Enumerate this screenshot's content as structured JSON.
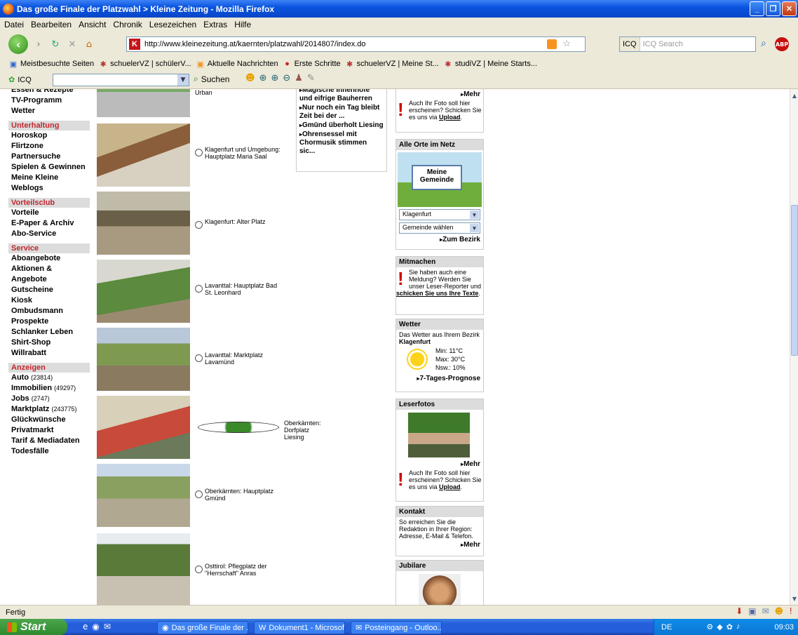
{
  "window": {
    "title": "Das große Finale der Platzwahl > Kleine Zeitung - Mozilla Firefox"
  },
  "menu": [
    "Datei",
    "Bearbeiten",
    "Ansicht",
    "Chronik",
    "Lesezeichen",
    "Extras",
    "Hilfe"
  ],
  "url": "http://www.kleinezeitung.at/kaernten/platzwahl/2014807/index.do",
  "search": {
    "placeholder": "ICQ Search",
    "label": "ICQ"
  },
  "bookmarks": [
    "Meistbesuchte Seiten",
    "schuelerVZ | schülerV...",
    "Aktuelle Nachrichten",
    "Erste Schritte",
    "schuelerVZ | Meine St...",
    "studiVZ | Meine Starts..."
  ],
  "icqbar": {
    "label": "ICQ",
    "search_button": "Suchen"
  },
  "leftnav": {
    "top_items": [
      "Essen & Rezepte",
      "TV-Programm",
      "Wetter"
    ],
    "sections": [
      {
        "head": "Unterhaltung",
        "items": [
          "Horoskop",
          "Flirtzone",
          "Partnersuche",
          "Spielen & Gewinnen",
          "Meine Kleine Weblogs"
        ]
      },
      {
        "head": "Vorteilsclub",
        "items": [
          "Vorteile",
          "E-Paper & Archiv",
          "Abo-Service"
        ]
      },
      {
        "head": "Service",
        "items": [
          "Aboangebote",
          "Aktionen & Angebote",
          "Gutscheine",
          "Kiosk",
          "Ombudsmann",
          "Prospekte",
          "Schlanker Leben",
          "Shirt-Shop",
          "Willrabatt"
        ]
      },
      {
        "head": "Anzeigen",
        "items": [
          {
            "label": "Auto",
            "count": "(23814)"
          },
          {
            "label": "Immobilien",
            "count": "(49297)"
          },
          {
            "label": "Jobs",
            "count": "(2747)"
          },
          {
            "label": "Marktplatz",
            "count": "(243775)"
          },
          {
            "label": "Glückwünsche",
            "count": ""
          },
          {
            "label": "Privatmarkt",
            "count": ""
          },
          {
            "label": "Tarif & Mediadaten",
            "count": ""
          },
          {
            "label": "Todesfälle",
            "count": ""
          }
        ]
      }
    ]
  },
  "places": [
    {
      "label": "Urban",
      "selected": false
    },
    {
      "label": "Klagenfurt und Umgebung: Hauptplatz Maria Saal",
      "selected": false
    },
    {
      "label": "Klagenfurt: Alter Platz",
      "selected": false
    },
    {
      "label": "Lavanttal: Hauptplatz Bad St. Leonhard",
      "selected": false
    },
    {
      "label": "Lavanttal: Marktplatz Lavamünd",
      "selected": false
    },
    {
      "label": "Oberkärnten: Dorfplatz Liesing",
      "selected": true
    },
    {
      "label": "Oberkärnten: Hauptplatz Gmünd",
      "selected": false
    },
    {
      "label": "Osttirol: Pflegplatz der \"Herrschaft\" Anras",
      "selected": false
    }
  ],
  "news": [
    "Magische Innenhöfe und eifrige Bauherren",
    "Nur noch ein Tag bleibt Zeit bei der ...",
    "Gmünd überholt Liesing",
    "Ohrensessel mit Chormusik stimmen sic..."
  ],
  "sidebar": {
    "more": "Mehr",
    "upload_text": "Auch Ihr Foto soll hier erscheinen? Schicken Sie es uns via",
    "upload_link": "Upload",
    "orte": {
      "head": "Alle Orte im Netz",
      "badge": "Meine Gemeinde",
      "select1": "Klagenfurt",
      "select2": "Gemeinde wählen",
      "link": "Zum Bezirk"
    },
    "mitmachen": {
      "head": "Mitmachen",
      "text": "Sie haben auch eine Meldung? Werden Sie unser Leser-Reporter und",
      "link": "schicken Sie uns Ihre Texte",
      "end": "."
    },
    "wetter": {
      "head": "Wetter",
      "text": "Das Wetter aus Ihrem Bezirk",
      "bezirk": "Klagenfurt",
      "min": "Min: 11°C",
      "max": "Max: 30°C",
      "nsw": "Nsw.: 10%",
      "link": "7-Tages-Prognose"
    },
    "leserfotos": {
      "head": "Leserfotos"
    },
    "kontakt": {
      "head": "Kontakt",
      "text": "So erreichen Sie die Redaktion in Ihrer Region: Adresse, E-Mail & Telefon."
    },
    "jubilare": {
      "head": "Jubilare"
    }
  },
  "status": "Fertig",
  "taskbar": {
    "start": "Start",
    "tasks": [
      "Das große Finale der ...",
      "Dokument1 - Microsof...",
      "Posteingang - Outloo..."
    ],
    "lang": "DE",
    "clock": "09:03"
  },
  "colors": {
    "accent": "#c1272d",
    "titlebar": "#0a55e0"
  }
}
